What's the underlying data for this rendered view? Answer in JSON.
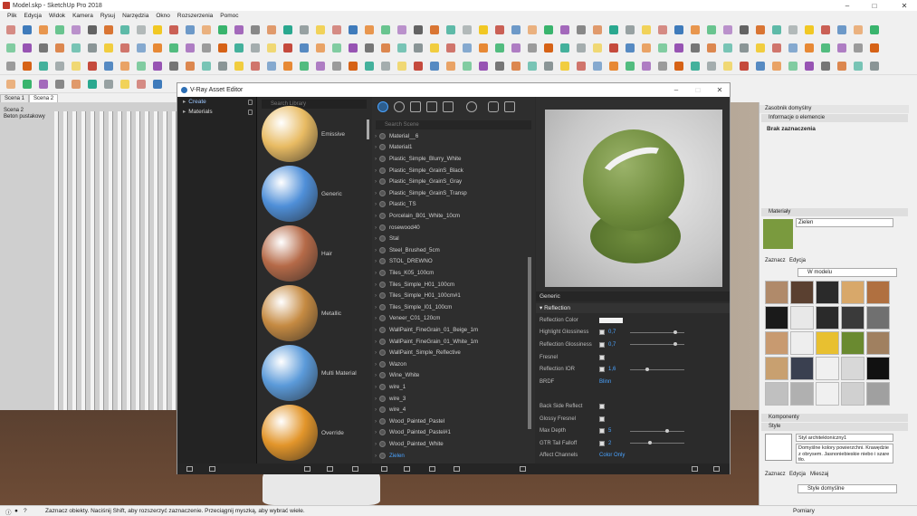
{
  "window": {
    "title": "Model.skp - SketchUp Pro 2018",
    "minimize": "–",
    "maximize": "□",
    "close": "✕"
  },
  "menu": [
    "Plik",
    "Edycja",
    "Widok",
    "Kamera",
    "Rysuj",
    "Narzędzia",
    "Okno",
    "Rozszerzenia",
    "Pomoc"
  ],
  "scenes": [
    "Scena 1",
    "Scena 2"
  ],
  "viewport": {
    "label_line1": "Scena 2",
    "label_line2": "Beton pustakowy"
  },
  "vray": {
    "title": "V-Ray Asset Editor",
    "tree": [
      {
        "label": "Create"
      },
      {
        "label": "Materials"
      }
    ],
    "search_library_placeholder": "Search Library",
    "search_scene_placeholder": "Search Scene",
    "templates": [
      {
        "label": "Emissive",
        "color": "#e8bb63"
      },
      {
        "label": "Generic",
        "color": "#4f8fd8"
      },
      {
        "label": "Hair",
        "color": "#b56a48"
      },
      {
        "label": "Metallic",
        "color": "#c58a42"
      },
      {
        "label": "Multi Material",
        "color": "#5b9ad9"
      },
      {
        "label": "Override",
        "color": "#e2952a"
      }
    ],
    "materials": [
      "Material__6",
      "Material1",
      "Plastic_Simple_Blurry_White",
      "Plastic_Simple_GrainS_Black",
      "Plastic_Simple_GrainS_Gray",
      "Plastic_Simple_GrainS_Transp",
      "Plastic_TS",
      "Porcelain_B01_White_10cm",
      "rosewood40",
      "Stal",
      "Steel_Brushed_5cm",
      "STOL_DREWNO",
      "Tiles_K05_100cm",
      "Tiles_Simple_H01_100cm",
      "Tiles_Simple_H01_100cm#1",
      "Tiles_Simple_I01_100cm",
      "Veneer_C01_120cm",
      "WallPaint_FineGrain_01_Beige_1m",
      "WallPaint_FineGrain_01_White_1m",
      "WallPaint_Simple_Reflective",
      "Wazon",
      "Wine_White",
      "wire_1",
      "wire_3",
      "wire_4",
      "Wood_Painted_Pastel",
      "Wood_Painted_Pastel#1",
      "Wood_Painted_White",
      "Zielen"
    ],
    "selected_material": "Zielen",
    "props": {
      "header": "Generic",
      "section": "Reflection",
      "rows": [
        {
          "label": "Reflection Color",
          "value": "",
          "kind": "color"
        },
        {
          "label": "Highlight Glossiness",
          "value": "0,7",
          "kind": "slider",
          "pos": 0.85
        },
        {
          "label": "Reflection Glossiness",
          "value": "0,7",
          "kind": "slider",
          "pos": 0.85
        },
        {
          "label": "Fresnel",
          "value": "",
          "kind": "check"
        },
        {
          "label": "Reflection IOR",
          "value": "1,6",
          "kind": "slider",
          "pos": 0.3
        },
        {
          "label": "BRDF",
          "value": "Blinn",
          "kind": "dropdown"
        },
        {
          "label": "",
          "value": "",
          "kind": "gap"
        },
        {
          "label": "Back Side Reflect",
          "value": "",
          "kind": "check"
        },
        {
          "label": "Glossy Fresnel",
          "value": "",
          "kind": "check"
        },
        {
          "label": "Max Depth",
          "value": "5",
          "kind": "slider",
          "pos": 0.7
        },
        {
          "label": "GTR Tail Falloff",
          "value": "2",
          "kind": "slider",
          "pos": 0.35
        },
        {
          "label": "Affect Channels",
          "value": "Color Only",
          "kind": "dropdown"
        }
      ]
    }
  },
  "tray": {
    "title": "Zasobnik domyślny",
    "entity_info": "Informacje o elemencie",
    "no_selection": "Brak zaznaczenia",
    "materials_section": "Materiały",
    "material_name": "Zielen",
    "tab_select": "Zaznacz",
    "tab_edit": "Edycja",
    "collection": "W modelu",
    "components": "Komponenty",
    "styles": "Style",
    "style_name": "Styl architektoniczny1",
    "style_desc": "Domyślne kolory powierzchni. Krawędzie z obrysem. Jasnoniebieskie niebo i szare tło.",
    "style_tab_mix": "Mieszaj",
    "style_collection": "Style domyślne",
    "swatches": [
      "#b08a6a",
      "#5a4030",
      "#2a2a2a",
      "#d8a86a",
      "#b07040",
      "#1a1a1a",
      "#e8e8e8",
      "#2a2a2a",
      "#3a3a3a",
      "#707070",
      "#c89a70",
      "#eeeeee",
      "#e8c030",
      "#6a8a30",
      "#a08060",
      "#c8a070",
      "#3a4050",
      "#f0f0f0",
      "#d8d8d8",
      "#111111",
      "#c0c0c0",
      "#b0b0b0",
      "#f0f0f0",
      "#d0d0d0",
      "#a0a0a0"
    ]
  },
  "status": {
    "text": "Zaznacz obiekty. Naciśnij Shift, aby rozszerzyć zaznaczenie. Przeciągnij myszką, aby wybrać wiele.",
    "measure": "Pomiary"
  }
}
